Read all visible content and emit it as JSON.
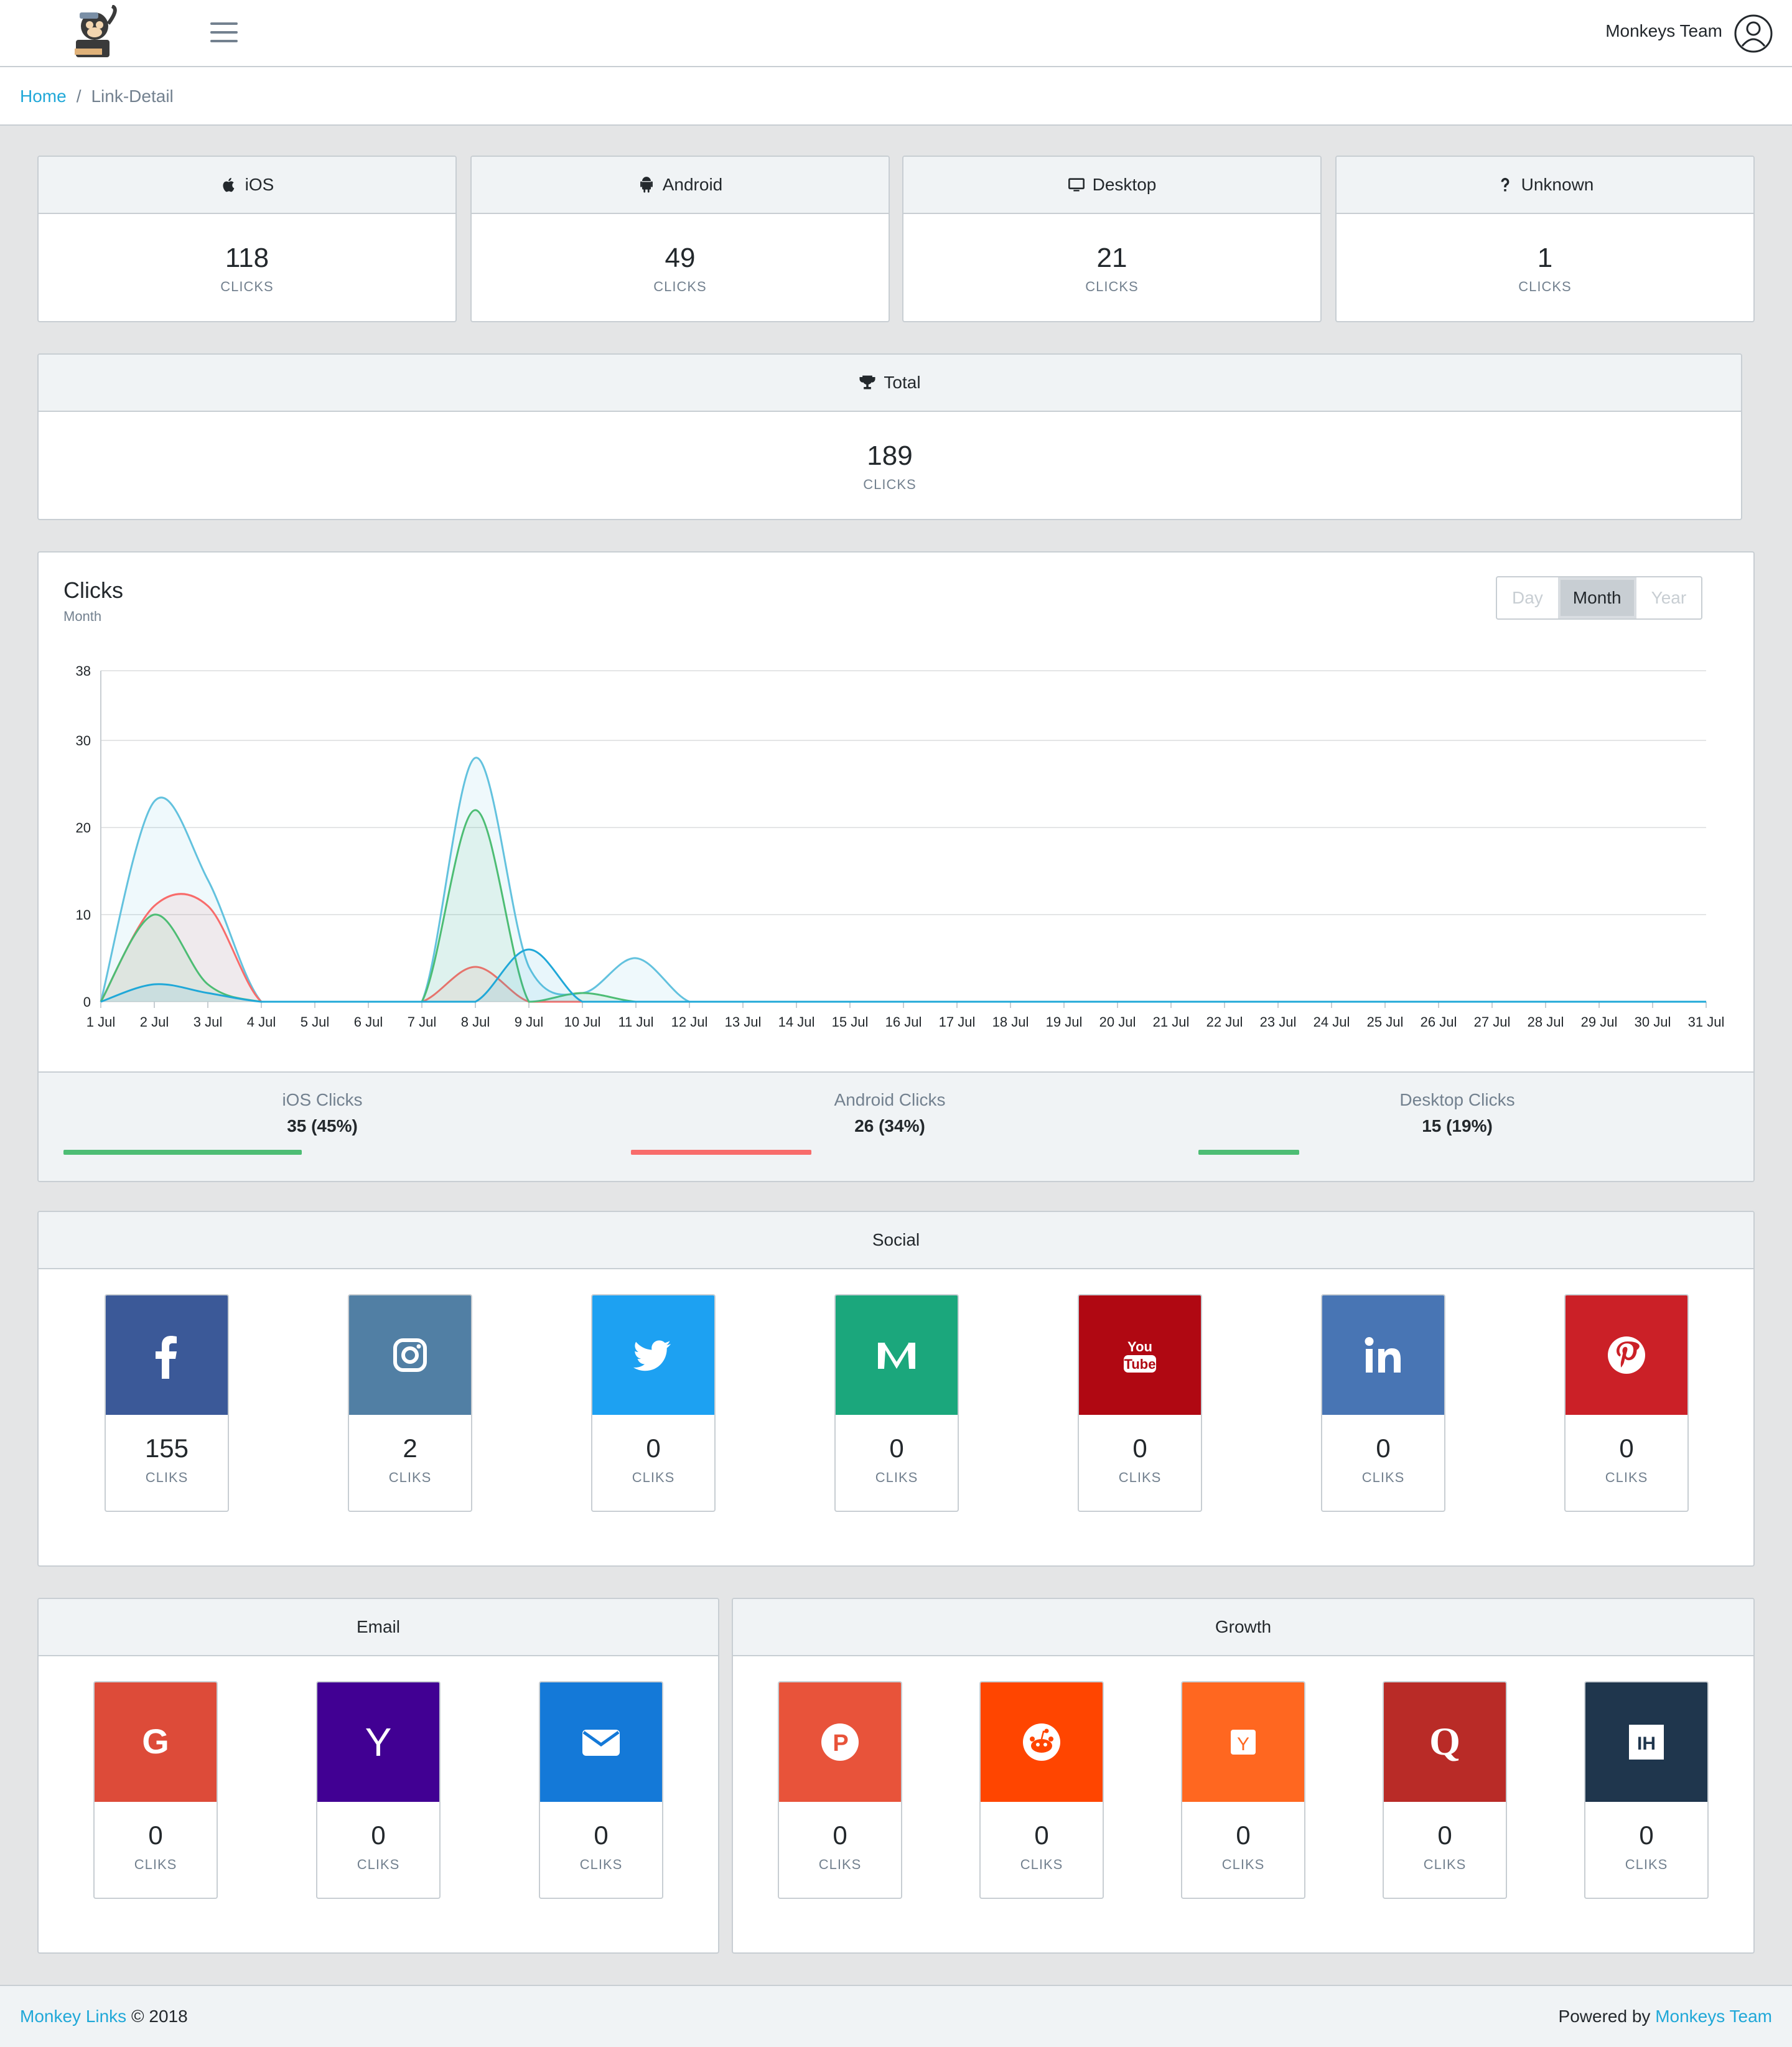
{
  "header": {
    "user_name": "Monkeys Team"
  },
  "breadcrumb": {
    "home": "Home",
    "separator": "/",
    "current": "Link-Detail"
  },
  "devices": [
    {
      "label": "iOS",
      "icon": "apple-icon",
      "value": "118",
      "unit": "CLICKS"
    },
    {
      "label": "Android",
      "icon": "android-icon",
      "value": "49",
      "unit": "CLICKS"
    },
    {
      "label": "Desktop",
      "icon": "desktop-icon",
      "value": "21",
      "unit": "CLICKS"
    },
    {
      "label": "Unknown",
      "icon": "question-icon",
      "value": "1",
      "unit": "CLICKS"
    }
  ],
  "total": {
    "label": "Total",
    "icon": "trophy-icon",
    "value": "189",
    "unit": "CLICKS"
  },
  "clicks_chart": {
    "title": "Clicks",
    "subtitle": "Month",
    "range_buttons": [
      "Day",
      "Month",
      "Year"
    ],
    "active_range": "Month"
  },
  "chart_data": {
    "type": "area",
    "ylim": [
      0,
      38
    ],
    "yticks": [
      0,
      10,
      20,
      30,
      38
    ],
    "x": [
      "1 Jul",
      "2 Jul",
      "3 Jul",
      "4 Jul",
      "5 Jul",
      "6 Jul",
      "7 Jul",
      "8 Jul",
      "9 Jul",
      "10 Jul",
      "11 Jul",
      "12 Jul",
      "13 Jul",
      "14 Jul",
      "15 Jul",
      "16 Jul",
      "17 Jul",
      "18 Jul",
      "19 Jul",
      "20 Jul",
      "21 Jul",
      "22 Jul",
      "23 Jul",
      "24 Jul",
      "25 Jul",
      "26 Jul",
      "27 Jul",
      "28 Jul",
      "29 Jul",
      "30 Jul",
      "31 Jul"
    ],
    "series": [
      {
        "color": "#63c2de",
        "values": [
          0,
          23,
          14,
          0,
          0,
          0,
          0,
          28,
          4,
          1,
          5,
          0,
          0,
          0,
          0,
          0,
          0,
          0,
          0,
          0,
          0,
          0,
          0,
          0,
          0,
          0,
          0,
          0,
          0,
          0,
          0
        ]
      },
      {
        "color": "#f86c6b",
        "values": [
          0,
          11,
          11,
          0,
          0,
          0,
          0,
          4,
          0,
          0,
          0,
          0,
          0,
          0,
          0,
          0,
          0,
          0,
          0,
          0,
          0,
          0,
          0,
          0,
          0,
          0,
          0,
          0,
          0,
          0,
          0
        ]
      },
      {
        "color": "#4dbd74",
        "values": [
          0,
          10,
          2,
          0,
          0,
          0,
          0,
          22,
          0,
          1,
          0,
          0,
          0,
          0,
          0,
          0,
          0,
          0,
          0,
          0,
          0,
          0,
          0,
          0,
          0,
          0,
          0,
          0,
          0,
          0,
          0
        ]
      },
      {
        "color": "#20a8d8",
        "values": [
          0,
          2,
          1,
          0,
          0,
          0,
          0,
          0,
          6,
          0,
          0,
          0,
          0,
          0,
          0,
          0,
          0,
          0,
          0,
          0,
          0,
          0,
          0,
          0,
          0,
          0,
          0,
          0,
          0,
          0,
          0
        ]
      }
    ],
    "grid": true,
    "legend": "none"
  },
  "chart_footer": [
    {
      "name": "iOS Clicks",
      "value": "35 (45%)",
      "percent": 45,
      "color": "#4dbd74"
    },
    {
      "name": "Android Clicks",
      "value": "26 (34%)",
      "percent": 34,
      "color": "#f86c6b"
    },
    {
      "name": "Desktop Clicks",
      "value": "15 (19%)",
      "percent": 19,
      "color": "#4dbd74"
    }
  ],
  "social": {
    "title": "Social",
    "items": [
      {
        "name": "facebook",
        "icon": "facebook-icon",
        "color": "#3b5998",
        "value": "155",
        "unit": "CLIKS"
      },
      {
        "name": "instagram",
        "icon": "instagram-icon",
        "color": "#517fa4",
        "value": "2",
        "unit": "CLIKS"
      },
      {
        "name": "twitter",
        "icon": "twitter-icon",
        "color": "#1da1f2",
        "value": "0",
        "unit": "CLIKS"
      },
      {
        "name": "medium",
        "icon": "medium-icon",
        "color": "#1ba77c",
        "value": "0",
        "unit": "CLIKS"
      },
      {
        "name": "youtube",
        "icon": "youtube-icon",
        "color": "#b00812",
        "value": "0",
        "unit": "CLIKS"
      },
      {
        "name": "linkedin",
        "icon": "linkedin-icon",
        "color": "#4875b4",
        "value": "0",
        "unit": "CLIKS"
      },
      {
        "name": "pinterest",
        "icon": "pinterest-icon",
        "color": "#cb2027",
        "value": "0",
        "unit": "CLIKS"
      }
    ]
  },
  "email": {
    "title": "Email",
    "items": [
      {
        "name": "gmail",
        "icon": "google-icon",
        "color": "#dd4b39",
        "value": "0",
        "unit": "CLIKS"
      },
      {
        "name": "yahoo",
        "icon": "yahoo-icon",
        "color": "#410093",
        "value": "0",
        "unit": "CLIKS"
      },
      {
        "name": "mail",
        "icon": "envelope-icon",
        "color": "#1479d8",
        "value": "0",
        "unit": "CLIKS"
      }
    ]
  },
  "growth": {
    "title": "Growth",
    "items": [
      {
        "name": "producthunt",
        "icon": "producthunt-icon",
        "color": "#e8533a",
        "value": "0",
        "unit": "CLIKS"
      },
      {
        "name": "reddit",
        "icon": "reddit-icon",
        "color": "#ff4500",
        "value": "0",
        "unit": "CLIKS"
      },
      {
        "name": "hackernews",
        "icon": "hackernews-icon",
        "color": "#ff6720",
        "value": "0",
        "unit": "CLIKS"
      },
      {
        "name": "quora",
        "icon": "quora-icon",
        "color": "#b92b27",
        "value": "0",
        "unit": "CLIKS"
      },
      {
        "name": "indiehackers",
        "icon": "indiehackers-icon",
        "color": "#1f364d",
        "value": "0",
        "unit": "CLIKS"
      }
    ]
  },
  "footer": {
    "brand": "Monkey Links",
    "copyright": "© 2018",
    "powered_by": "Powered by",
    "team": "Monkeys Team"
  }
}
